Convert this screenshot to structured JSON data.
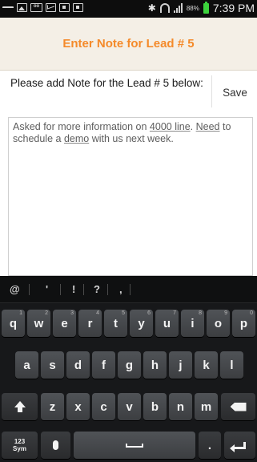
{
  "status_bar": {
    "battery_percent": "88%",
    "time": "7:39 PM",
    "icons": [
      "usb-icon",
      "picture-icon",
      "voicemail-icon",
      "mail-icon",
      "download-icon",
      "download-icon",
      "bluetooth-icon",
      "wifi-icon",
      "signal-icon",
      "battery-icon"
    ]
  },
  "header": {
    "title": "Enter Note for Lead # 5"
  },
  "prompt": {
    "text": "Please add Note for the Lead # 5 below:",
    "save_label": "Save"
  },
  "note": {
    "seg1": "Asked for more information on ",
    "seg2": "4000 line",
    "seg3": ". ",
    "seg4": "Need",
    "seg5": " to schedule a ",
    "seg6": "demo",
    "seg7": " with us next week."
  },
  "keyboard": {
    "suggestions": [
      "@",
      "'",
      "!",
      "?",
      ","
    ],
    "row1": [
      "q",
      "w",
      "e",
      "r",
      "t",
      "y",
      "u",
      "i",
      "o",
      "p"
    ],
    "row1_hints": [
      "1",
      "2",
      "3",
      "4",
      "5",
      "6",
      "7",
      "8",
      "9",
      "0"
    ],
    "row2": [
      "a",
      "s",
      "d",
      "f",
      "g",
      "h",
      "j",
      "k",
      "l"
    ],
    "row3": [
      "z",
      "x",
      "c",
      "v",
      "b",
      "n",
      "m"
    ],
    "sym_top": "123",
    "sym_bottom": "Sym",
    "period": "."
  },
  "colors": {
    "title": "#f48a2a",
    "battery": "#3cd23c",
    "keyboard_bg": "#17181a"
  }
}
